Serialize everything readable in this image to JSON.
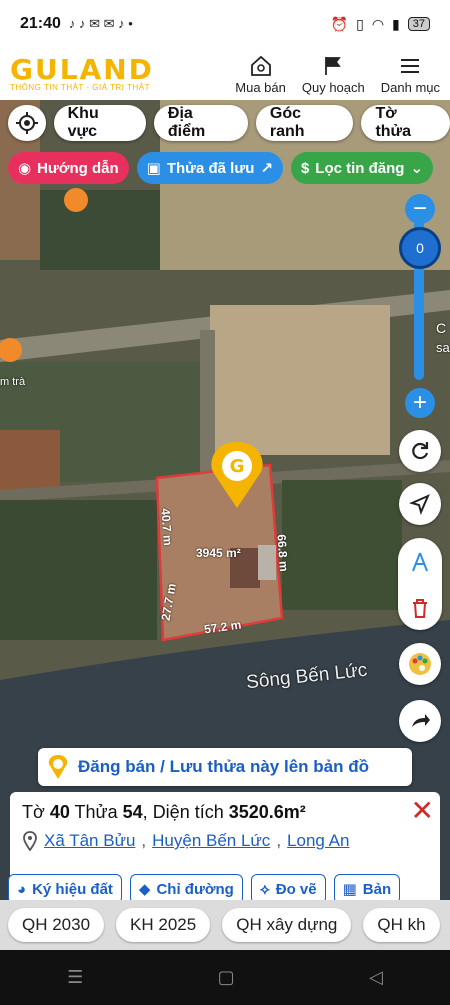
{
  "status_bar": {
    "time": "21:40",
    "battery": "37"
  },
  "app": {
    "logo": "GULAND",
    "tagline": "THÔNG TIN THẬT - GIÁ TRỊ THẬT",
    "nav": [
      {
        "label": "Mua bán",
        "icon": "house-search-icon"
      },
      {
        "label": "Quy hoạch",
        "icon": "map-flag-icon"
      },
      {
        "label": "Danh mục",
        "icon": "menu-icon"
      }
    ]
  },
  "toolbar": {
    "filters": [
      "Khu vực",
      "Địa điểm",
      "Góc ranh",
      "Tờ thửa"
    ],
    "chips": {
      "guide": "Hướng dẫn",
      "saved": "Thửa đã lưu",
      "filter": "Lọc tin đăng"
    }
  },
  "map": {
    "zoom_level": "0",
    "labels": {
      "cafe": "m trà",
      "river": "Sông Bến Lức",
      "right_c": "C",
      "right_sa": "sa"
    },
    "parcel": {
      "area_label": "3945 m²",
      "dims": [
        "40.7 m",
        "66.8 m",
        "27.7 m",
        "57.2 m"
      ]
    },
    "colors": {
      "parcel_outline": "#e03a3a",
      "pin": "#f5b400",
      "accent_blue": "#2c8fe6"
    }
  },
  "post_banner": {
    "text": "Đăng bán / Lưu thửa này lên bản đồ"
  },
  "info": {
    "to_label": "Tờ",
    "to_value": "40",
    "thua_label": "Thửa",
    "thua_value": "54",
    "area_label": "Diện tích",
    "area_value": "3520.6m²",
    "address": {
      "ward": "Xã Tân Bửu",
      "district": "Huyện Bến Lức",
      "province": "Long An"
    },
    "actions": [
      "Ký hiệu đất",
      "Chỉ đường",
      "Đo vẽ",
      "Bản"
    ]
  },
  "plans": [
    "QH 2030",
    "KH 2025",
    "QH xây dựng",
    "QH kh"
  ]
}
